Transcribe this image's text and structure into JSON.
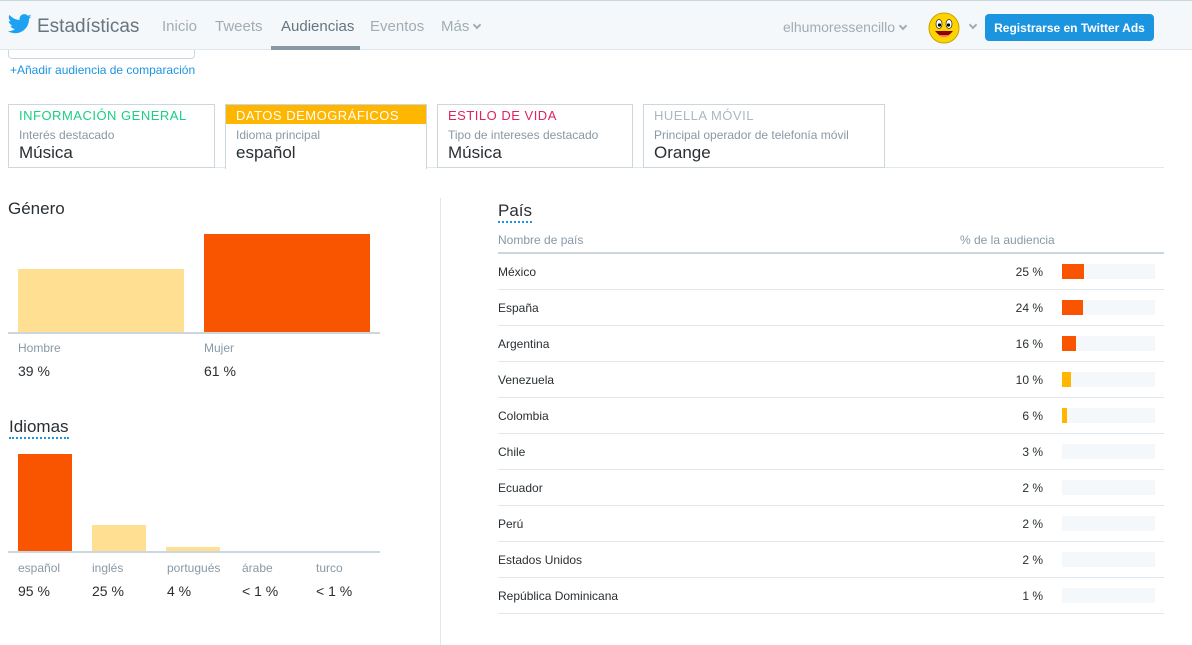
{
  "nav": {
    "brand": "Estadísticas",
    "items": [
      "Inicio",
      "Tweets",
      "Audiencias",
      "Eventos",
      "Más"
    ],
    "username": "elhumoressencillo",
    "ads_button": "Registrarse en Twitter Ads"
  },
  "compare_link": "+Añadir audiencia de comparación",
  "tabs": [
    {
      "head": "INFORMACIÓN GENERAL",
      "sub": "Interés destacado",
      "value": "Música",
      "color": "#19cf86"
    },
    {
      "head": "DATOS DEMOGRÁFICOS",
      "sub": "Idioma principal",
      "value": "español",
      "color": "#ffb600"
    },
    {
      "head": "ESTILO DE VIDA",
      "sub": "Tipo de intereses destacado",
      "value": "Música",
      "color": "#e0245e"
    },
    {
      "head": "HUELLA MÓVIL",
      "sub": "Principal operador de telefonía móvil",
      "value": "Orange",
      "color": "#aab8c2"
    }
  ],
  "gender": {
    "title": "Género",
    "labels": [
      "Hombre",
      "Mujer"
    ],
    "pcts": [
      "39 %",
      "61 %"
    ],
    "values": [
      39,
      61
    ]
  },
  "languages": {
    "title": "Idiomas",
    "labels": [
      "español",
      "inglés",
      "portugués",
      "árabe",
      "turco"
    ],
    "pcts": [
      "95 %",
      "25 %",
      "4 %",
      "< 1 %",
      "< 1 %"
    ],
    "values": [
      95,
      25,
      4,
      0,
      0
    ]
  },
  "country": {
    "title": "País",
    "col_name": "Nombre de país",
    "col_pct": "% de la audiencia",
    "rows": [
      {
        "name": "México",
        "pct": "25 %",
        "value": 25
      },
      {
        "name": "España",
        "pct": "24 %",
        "value": 24
      },
      {
        "name": "Argentina",
        "pct": "16 %",
        "value": 16
      },
      {
        "name": "Venezuela",
        "pct": "10 %",
        "value": 10
      },
      {
        "name": "Colombia",
        "pct": "6 %",
        "value": 6
      },
      {
        "name": "Chile",
        "pct": "3 %",
        "value": 3
      },
      {
        "name": "Ecuador",
        "pct": "2 %",
        "value": 2
      },
      {
        "name": "Perú",
        "pct": "2 %",
        "value": 2
      },
      {
        "name": "Estados Unidos",
        "pct": "2 %",
        "value": 2
      },
      {
        "name": "República Dominicana",
        "pct": "1 %",
        "value": 1
      }
    ]
  },
  "colors": {
    "high": "#f95400",
    "mid": "#ffb600",
    "low": "#ffdf92",
    "accent": "#1b95e0"
  }
}
